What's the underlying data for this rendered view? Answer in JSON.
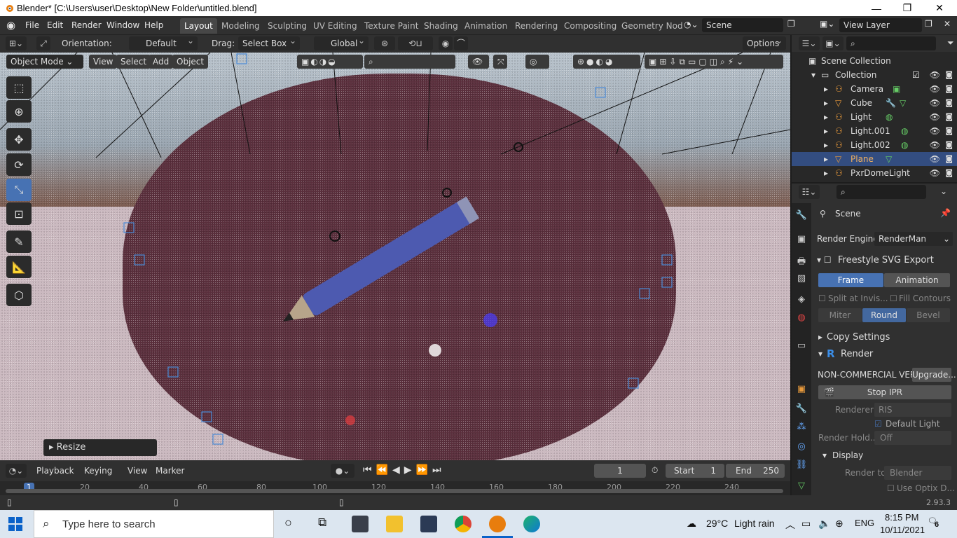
{
  "window": {
    "title": "Blender* [C:\\Users\\user\\Desktop\\New Folder\\untitled.blend]",
    "minimize": "—",
    "maximize": "❐",
    "close": "✕"
  },
  "menu": [
    "File",
    "Edit",
    "Render",
    "Window",
    "Help"
  ],
  "workspaces": [
    "Layout",
    "Modeling",
    "Sculpting",
    "UV Editing",
    "Texture Paint",
    "Shading",
    "Animation",
    "Rendering",
    "Compositing",
    "Geometry Nod"
  ],
  "scene_field": "Scene",
  "view_layer_field": "View Layer",
  "header": {
    "orientation_label": "Orientation:",
    "orientation_value": "Default",
    "drag_label": "Drag:",
    "drag_value": "Select Box",
    "transform_value": "Global",
    "options": "Options"
  },
  "viewport_header": {
    "mode": "Object Mode",
    "view": "View",
    "select": "Select",
    "add": "Add",
    "object": "Object"
  },
  "resize_panel": "Resize",
  "timeline": {
    "playback": "Playback",
    "keying": "Keying",
    "view": "View",
    "marker": "Marker",
    "current_frame": "1",
    "start_label": "Start",
    "start_value": "1",
    "end_label": "End",
    "end_value": "250"
  },
  "ruler_ticks": [
    "1",
    "20",
    "40",
    "60",
    "80",
    "100",
    "120",
    "140",
    "160",
    "180",
    "200",
    "220",
    "240"
  ],
  "outliner": {
    "root": "Scene Collection",
    "collection": "Collection",
    "items": [
      {
        "name": "Camera",
        "selected": false
      },
      {
        "name": "Cube",
        "selected": false
      },
      {
        "name": "Light",
        "selected": false
      },
      {
        "name": "Light.001",
        "selected": false
      },
      {
        "name": "Light.002",
        "selected": false
      },
      {
        "name": "Plane",
        "selected": true
      },
      {
        "name": "PxrDomeLight",
        "selected": false
      }
    ]
  },
  "properties": {
    "context": "Scene",
    "render_engine_label": "Render Engine",
    "render_engine_value": "RenderMan",
    "freestyle": "Freestyle SVG Export",
    "frame": "Frame",
    "animation": "Animation",
    "split_at_invis": "Split at Invis...",
    "fill_contours": "Fill Contours",
    "miter": "Miter",
    "round": "Round",
    "bevel": "Bevel",
    "copy_settings": "Copy Settings",
    "render": "Render",
    "noncommercial": "NON-COMMERCIAL VER...",
    "upgrade": "Upgrade...",
    "stop_ipr": "Stop IPR",
    "renderer_label": "Renderer",
    "renderer_value": "RIS",
    "default_light": "Default Light",
    "render_hold_label": "Render Hold...",
    "render_hold_value": "Off",
    "display": "Display",
    "render_to_label": "Render to",
    "render_to_value": "Blender",
    "use_optix": "Use Optix D..."
  },
  "version": "2.93.3",
  "taskbar": {
    "search_placeholder": "Type here to search",
    "weather_temp": "29°C",
    "weather_text": "Light rain",
    "lang": "ENG",
    "time": "8:15 PM",
    "date": "10/11/2021",
    "notifications": "6"
  }
}
